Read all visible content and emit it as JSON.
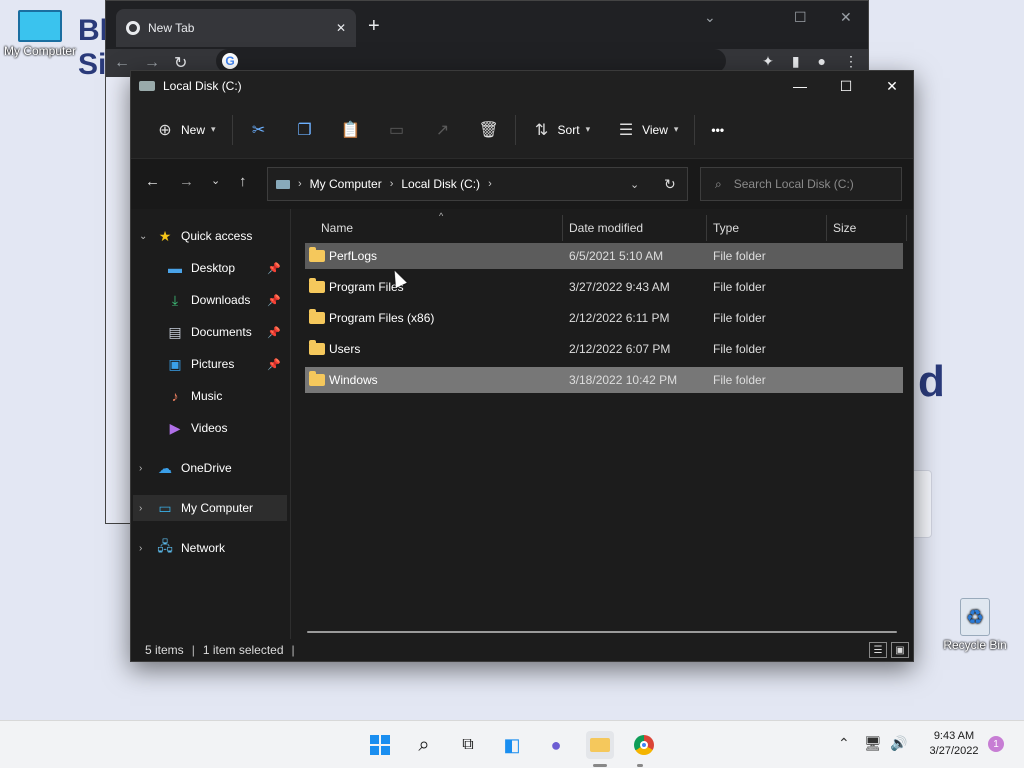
{
  "desktop": {
    "icons": [
      {
        "label": "My Computer"
      },
      {
        "label": "Recycle Bin"
      }
    ],
    "bg_text": [
      "Bl",
      "Si",
      "d"
    ]
  },
  "chrome": {
    "tab_title": "New Tab",
    "omnibox_g": "G"
  },
  "explorer": {
    "title": "Local Disk (C:)",
    "cmdbar": {
      "new_label": "New",
      "sort_label": "Sort",
      "view_label": "View",
      "more_label": "•••"
    },
    "address": {
      "crumbs": [
        "My Computer",
        "Local Disk (C:)"
      ]
    },
    "search": {
      "placeholder": "Search Local Disk (C:)"
    },
    "sidebar": {
      "quick_access": "Quick access",
      "items": [
        {
          "label": "Desktop"
        },
        {
          "label": "Downloads"
        },
        {
          "label": "Documents"
        },
        {
          "label": "Pictures"
        },
        {
          "label": "Music"
        },
        {
          "label": "Videos"
        }
      ],
      "onedrive": "OneDrive",
      "my_computer": "My Computer",
      "network": "Network"
    },
    "columns": {
      "name": "Name",
      "date": "Date modified",
      "type": "Type",
      "size": "Size"
    },
    "files": [
      {
        "name": "PerfLogs",
        "date": "6/5/2021 5:10 AM",
        "type": "File folder"
      },
      {
        "name": "Program Files",
        "date": "3/27/2022 9:43 AM",
        "type": "File folder"
      },
      {
        "name": "Program Files (x86)",
        "date": "2/12/2022 6:11 PM",
        "type": "File folder"
      },
      {
        "name": "Users",
        "date": "2/12/2022 6:07 PM",
        "type": "File folder"
      },
      {
        "name": "Windows",
        "date": "3/18/2022 10:42 PM",
        "type": "File folder"
      }
    ],
    "status": {
      "items": "5 items",
      "selected": "1 item selected"
    }
  },
  "taskbar": {
    "time": "9:43 AM",
    "date": "3/27/2022",
    "notifications": "1"
  }
}
